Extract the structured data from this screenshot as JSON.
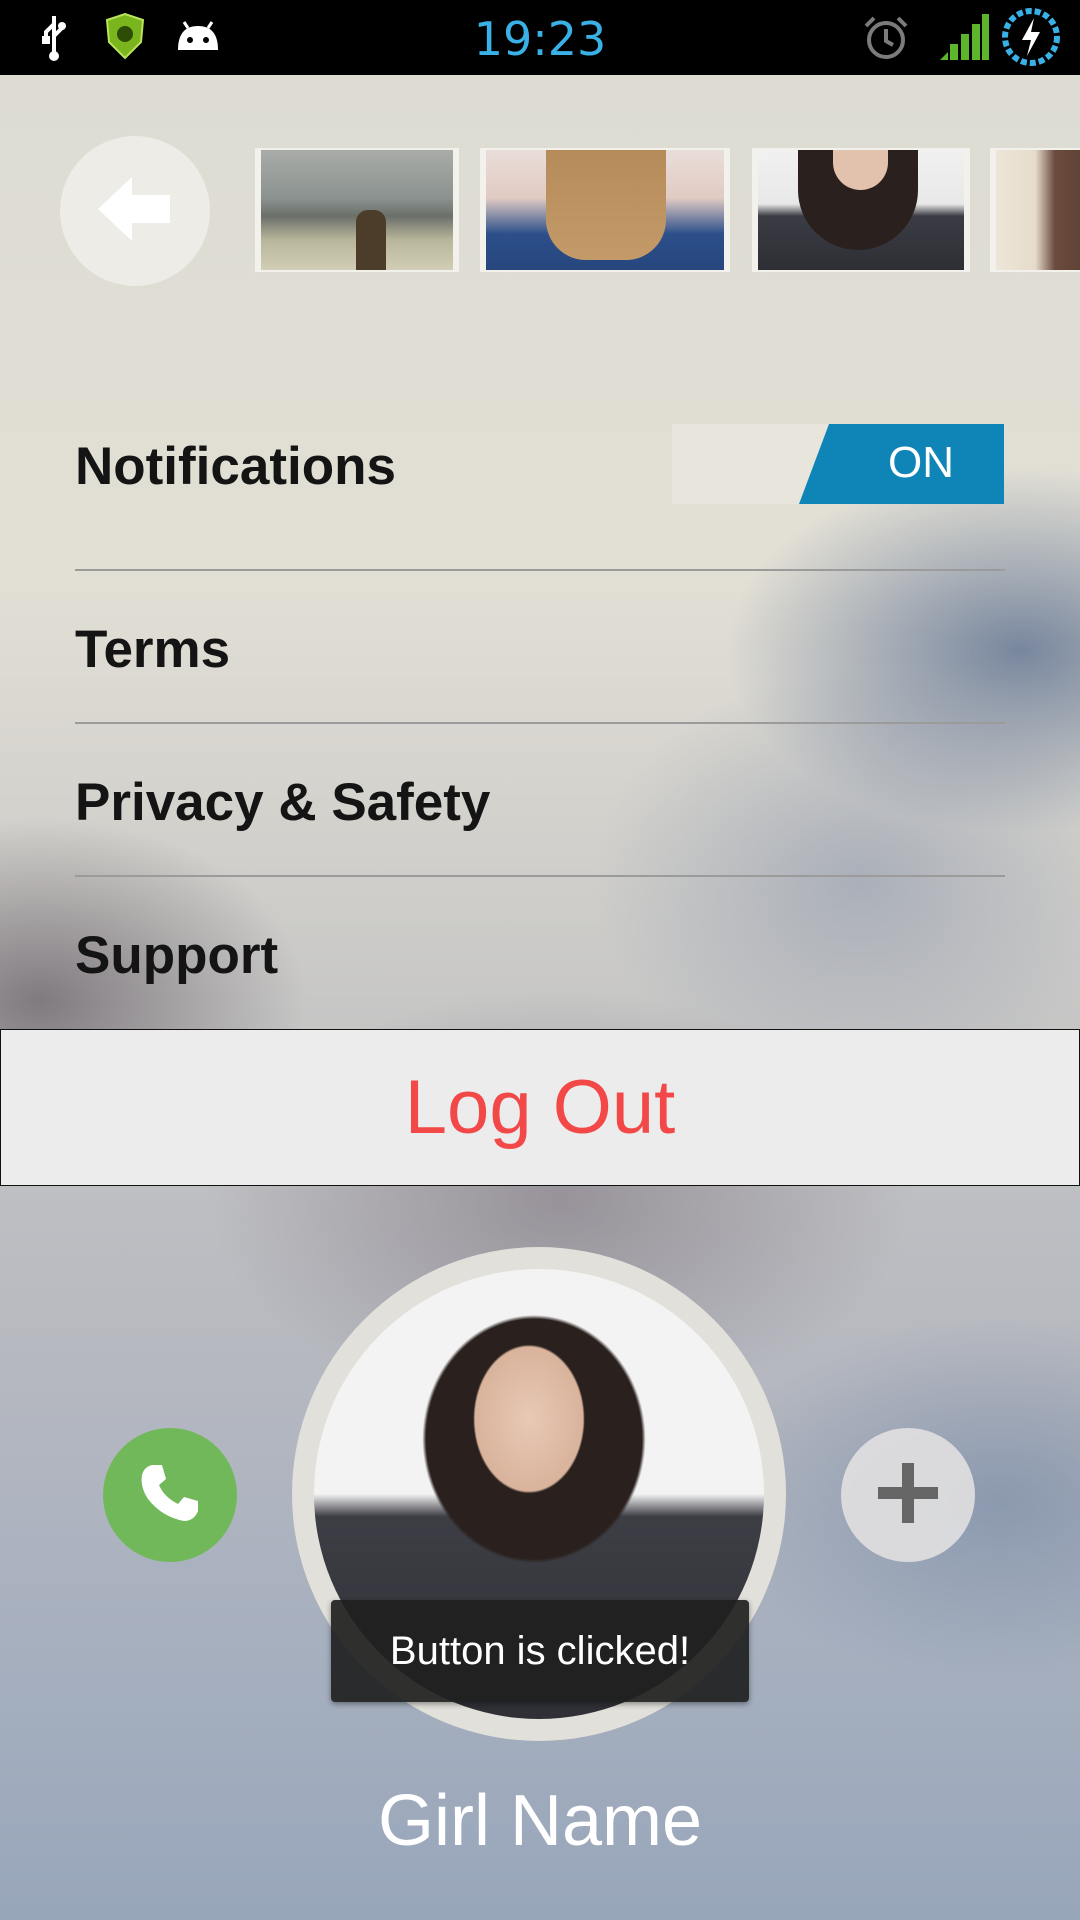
{
  "status_bar": {
    "time": "19:23",
    "left_icons": [
      "usb-icon",
      "shield-app-icon",
      "android-debug-icon"
    ],
    "right_icons": [
      "alarm-icon",
      "signal-icon",
      "battery-charging-icon"
    ],
    "time_color": "#39b1e7"
  },
  "header": {
    "back_icon": "back-arrow-icon",
    "thumbnails": [
      {
        "name": "photo-thumb-1"
      },
      {
        "name": "photo-thumb-2"
      },
      {
        "name": "photo-thumb-3"
      },
      {
        "name": "photo-thumb-4"
      }
    ]
  },
  "settings": {
    "notifications": {
      "label": "Notifications",
      "toggle_state": "ON"
    },
    "items": [
      {
        "label": "Terms"
      },
      {
        "label": "Privacy & Safety"
      },
      {
        "label": "Support"
      }
    ],
    "logout_label": "Log Out",
    "toggle_color": "#0f84b6",
    "logout_color": "#f24848"
  },
  "profile": {
    "call_icon": "phone-icon",
    "add_icon": "plus-icon",
    "call_color": "#71b85a",
    "name": "Girl Name",
    "toast": "Button is clicked!"
  }
}
